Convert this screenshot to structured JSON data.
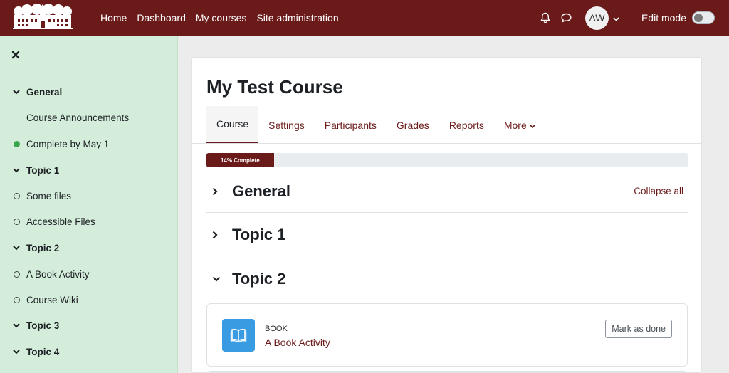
{
  "navbar": {
    "links": [
      "Home",
      "Dashboard",
      "My courses",
      "Site administration"
    ],
    "user_initials": "AW",
    "edit_mode_label": "Edit mode",
    "edit_mode_on": false,
    "bg_color": "#6b1a1a"
  },
  "drawer": {
    "items": [
      {
        "type": "section",
        "label": "General"
      },
      {
        "type": "plain",
        "label": "Course Announcements"
      },
      {
        "type": "complete",
        "label": "Complete by May 1"
      },
      {
        "type": "section",
        "label": "Topic 1"
      },
      {
        "type": "incomplete",
        "label": "Some files"
      },
      {
        "type": "incomplete",
        "label": "Accessible Files"
      },
      {
        "type": "section",
        "label": "Topic 2"
      },
      {
        "type": "incomplete",
        "label": "A Book Activity"
      },
      {
        "type": "incomplete",
        "label": "Course Wiki"
      },
      {
        "type": "section",
        "label": "Topic 3"
      },
      {
        "type": "section",
        "label": "Topic 4"
      }
    ],
    "bg_color": "#d4edda"
  },
  "course": {
    "title": "My Test Course",
    "tabs": [
      "Course",
      "Settings",
      "Participants",
      "Grades",
      "Reports",
      "More"
    ],
    "active_tab": "Course",
    "progress_label": "14% Complete",
    "progress_percent": 14,
    "collapse_all": "Collapse all",
    "sections": [
      {
        "title": "General",
        "expanded": false
      },
      {
        "title": "Topic 1",
        "expanded": false
      },
      {
        "title": "Topic 2",
        "expanded": true
      }
    ],
    "activity": {
      "type": "BOOK",
      "name": "A Book Activity",
      "button": "Mark as done",
      "icon": "book-icon",
      "icon_color": "#399be2"
    }
  }
}
